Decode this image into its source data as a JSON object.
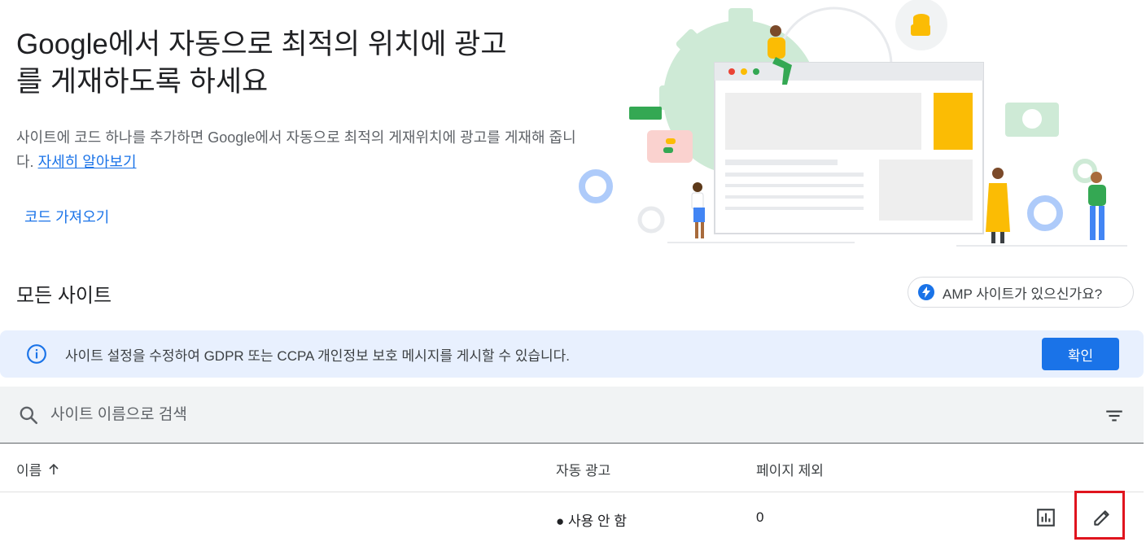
{
  "hero": {
    "title_line1": "Google에서 자동으로 최적의 위치에 광고",
    "title_line2": "를 게재하도록 하세요",
    "description": "사이트에 코드 하나를 추가하면 Google에서 자동으로 최적의 게재위치에 광고를 게재해 줍니다.",
    "learn_more": "자세히 알아보기",
    "get_code": "코드 가져오기"
  },
  "sites": {
    "section_title": "모든 사이트",
    "amp_button": "AMP 사이트가 있으신가요?"
  },
  "banner": {
    "message": "사이트 설정을 수정하여 GDPR 또는 CCPA 개인정보 보호 메시지를 게시할 수 있습니다.",
    "confirm": "확인"
  },
  "search": {
    "placeholder": "사이트 이름으로 검색"
  },
  "table": {
    "columns": {
      "name": "이름",
      "auto_ads": "자동 광고",
      "page_exclusions": "페이지 제외"
    },
    "rows": [
      {
        "name": "",
        "auto_ads": "● 사용 안 함",
        "page_exclusions": "0"
      }
    ]
  },
  "colors": {
    "accent": "#1a73e8",
    "banner_bg": "#e8f0fe",
    "highlight": "#e0141e"
  }
}
